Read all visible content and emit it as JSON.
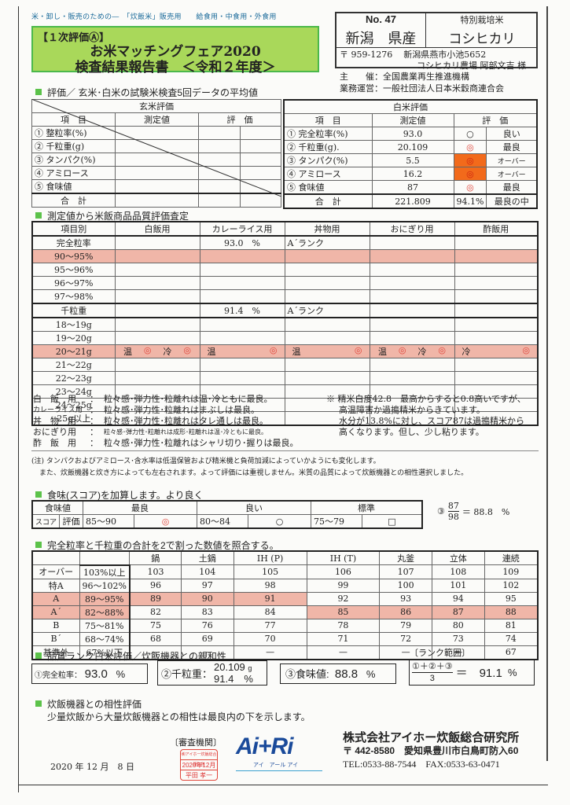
{
  "header": {
    "tagline": "米・卸し・販売のための―　「炊飯米」販売用　　給食用・中食用・外食用",
    "eval_label": "【１次評価Ⓐ】",
    "title_line1": "お米マッチングフェア2020",
    "title_line2": "検査結果報告書　＜令和２年度＞"
  },
  "entry": {
    "no": "No. 47",
    "special": "特別栽培米",
    "prefecture": "新潟　県産",
    "variety": "コシヒカリ",
    "postal": "〒 959-1276",
    "address": "新潟県燕市小池5652",
    "farm": "コシヒカリ農場 阿部文吉 様"
  },
  "organizers": {
    "host": "主　　催：全国農業再生推進機構",
    "operator": "業務運営：一般社団法人日本米穀商連合会"
  },
  "section1": {
    "heading": "評価／ 玄米･白米の試験米検査5回データの平均値",
    "brown": {
      "title": "玄米評価",
      "headers": [
        "項　目",
        "測定値",
        "評　価"
      ],
      "items": [
        "① 整粒率(%)",
        "② 千粒重(g)",
        "③ タンパク(%)",
        "④ アミロース",
        "⑤ 食味値"
      ],
      "total": "合　計"
    },
    "white": {
      "title": "白米評価",
      "headers": [
        "項　目",
        "測定値",
        "評　価"
      ],
      "rows": [
        {
          "item": "① 完全粒率(%)",
          "value": "93.0",
          "mark": "○",
          "grade": "良い"
        },
        {
          "item": "② 千粒重(g).",
          "value": "20.109",
          "mark": "◎",
          "grade": "最良"
        },
        {
          "item": "③ タンパク(%)",
          "value": "5.5",
          "mark": "◎",
          "grade": "オーバー"
        },
        {
          "item": "④ アミロース",
          "value": "16.2",
          "mark": "◎",
          "grade": "オーバー"
        },
        {
          "item": "⑤ 食味値",
          "value": "87",
          "mark": "◎",
          "grade": "最良"
        }
      ],
      "total_label": "合　計",
      "total_value": "221.809",
      "total_pct": "94.1%",
      "total_grade": "最良の中"
    }
  },
  "section2": {
    "heading": "測定値から米飯商品品質評価査定",
    "headers": [
      "項目別",
      "白飯用",
      "カレーライス用",
      "丼物用",
      "おにぎり用",
      "酢飯用"
    ],
    "kanzen_label": "完全粒率",
    "kanzen_value": "93.0　%",
    "kanzen_rank": "A´ランク",
    "kanzen_rows": [
      "90～95%",
      "95～96%",
      "96～97%",
      "97～98%"
    ],
    "sen_label": "千粒重",
    "sen_value": "91.4　%",
    "sen_rank": "A´ランク",
    "sen_rows": [
      "18～19g",
      "19～20g",
      "20～21g",
      "21～22g",
      "22～23g",
      "23～24g",
      "24～25g",
      "25g以上"
    ],
    "highlight_cells": {
      "hakuhan": [
        "温",
        "◎",
        "冷",
        "◎"
      ],
      "curry": [
        "温",
        "◎"
      ],
      "donburi": [
        "温",
        "◎"
      ],
      "onigiri": [
        "温",
        "◎",
        "冷",
        "◎"
      ],
      "sumeshi": [
        "冷",
        "◎"
      ]
    }
  },
  "comments": {
    "rows": [
      {
        "label": "白　飯　用",
        "text": "粒々感･弾力性･粒離れは温･冷ともに最良。"
      },
      {
        "label": "カレーライス用",
        "text": "粒々感･弾力性･粒離れはまぶしは最良。"
      },
      {
        "label": "丼　物　用",
        "text": "粒々感･弾力性･粒離れはタレ通しは最良。"
      },
      {
        "label": "おにぎり用",
        "text": "粒々感･弾力性･粒離れは成形･粒離れは温･冷ともに最良。"
      },
      {
        "label": "酢　飯　用",
        "text": "粒々感･弾力性･粒離れはシャリ切り･握りは最良。"
      }
    ],
    "colon": "：",
    "remark": [
      "※ 精米白度42.8　最高からすると0.8高いですが、",
      "高温障害か過搗精米からきています。",
      "水分が13.8%に対し、スコア87は過搗精米から",
      "高くなります。但し、少し粘ります。"
    ]
  },
  "caution": [
    "(注) タンパクおよびアミロース･含水率は低温保管および精米機と負荷加減によっていかようにも変化します。",
    "また、炊飯機器と炊き方によっても左右されます。よって評価には重視しません。米質の品質によって炊飯機器との相性選択しました。"
  ],
  "section3": {
    "heading": "食味(スコア)を加算します。より良く",
    "head": [
      "食味値",
      "最良",
      "良い",
      "標準"
    ],
    "sub": [
      "スコア",
      "評価"
    ],
    "ranges": [
      {
        "range": "85～90",
        "mark": "◎"
      },
      {
        "range": "80～84",
        "mark": "○"
      },
      {
        "range": "75～79",
        "mark": "□"
      }
    ],
    "formula_num": "③",
    "numerator": "87",
    "denominator": "98",
    "result": "＝ 88.8　%"
  },
  "section4": {
    "heading": "完全粒率と千粒重の合計を2で割った数値を照合する。",
    "columns": [
      "鍋",
      "土鍋",
      "IH (P)",
      "IH (T)",
      "丸釜",
      "立体",
      "連続"
    ],
    "rows": [
      {
        "rank": "オーバー",
        "range": "103%以上",
        "values": [
          "103",
          "104",
          "105",
          "106",
          "107",
          "108",
          "109"
        ]
      },
      {
        "rank": "特A",
        "range": "96～102%",
        "values": [
          "96",
          "97",
          "98",
          "99",
          "100",
          "101",
          "102"
        ]
      },
      {
        "rank": "A",
        "range": "89～95%",
        "values": [
          "89",
          "90",
          "91",
          "92",
          "93",
          "94",
          "95"
        ]
      },
      {
        "rank": "A´",
        "range": "82～88%",
        "values": [
          "82",
          "83",
          "84",
          "85",
          "86",
          "87",
          "88"
        ]
      },
      {
        "rank": "B",
        "range": "75～81%",
        "values": [
          "75",
          "76",
          "77",
          "78",
          "79",
          "80",
          "81"
        ]
      },
      {
        "rank": "B´",
        "range": "68～74%",
        "values": [
          "68",
          "69",
          "70",
          "71",
          "72",
          "73",
          "74"
        ]
      },
      {
        "rank": "基準外",
        "range": "67%以下",
        "values": [
          "—",
          "—",
          "—",
          "—",
          "—",
          "—",
          "67"
        ]
      }
    ]
  },
  "section5": {
    "heading": "品質ランク白米評価／炊飯機器との親和性",
    "rank_range_label": "〔ランク範囲〕",
    "kanzen_label": "①完全粒率：",
    "kanzen_value": "93.0",
    "kanzen_unit": "%",
    "sen_label": "②千粒重：",
    "sen_g": "20.109",
    "sen_g_unit": "g",
    "sen_pct": "91.4　%",
    "shokumi_label": "③食味値:",
    "shokumi_value": "88.8",
    "shokumi_unit": "%",
    "formula_num": "①＋②＋③",
    "formula_den": "3",
    "formula_result": "＝　91.1",
    "formula_unit": "%"
  },
  "section6": {
    "heading": "炊飯機器との相性評価",
    "text": "少量炊飯から大量炊飯機器との相性は最良内の下を示します。"
  },
  "footer": {
    "date": "2020 年 12 月　8 日",
    "review_label": "〔審査機関〕",
    "stamp_line1": "㈱アイホー炊飯総合研究所",
    "stamp_line2": "2020年12月",
    "stamp_line3": "平田 孝一",
    "logo_text": "Ai+Ri",
    "logo_kana": "アイ　アール アイ",
    "company": "株式会社アイホー炊飯総合研究所",
    "company_addr": "〒 442-8580　愛知県豊川市白鳥町防入60",
    "company_tel": "TEL:0533-88-7544　FAX:0533-63-0471"
  }
}
